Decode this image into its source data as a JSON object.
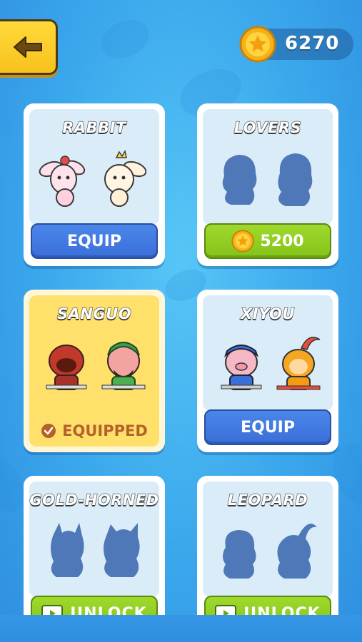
{
  "colors": {
    "accent": "#3b6fd8",
    "buy": "#84c31a",
    "equipped": "#ffe06a",
    "equipped_text": "#b5612a",
    "background": "#3aa7ec"
  },
  "header": {
    "coins": "6270"
  },
  "cards": [
    {
      "title": "RABBIT",
      "action_label": "EQUIP",
      "state": "owned"
    },
    {
      "title": "LOVERS",
      "action_label": "5200",
      "state": "locked-price"
    },
    {
      "title": "SANGUO",
      "action_label": "EQUIPPED",
      "state": "equipped"
    },
    {
      "title": "XIYOU",
      "action_label": "EQUIP",
      "state": "owned"
    },
    {
      "title": "GOLD-HORNED",
      "action_label": "UNLOCK",
      "state": "locked-video"
    },
    {
      "title": "LEOPARD",
      "action_label": "UNLOCK",
      "state": "locked-video"
    }
  ]
}
